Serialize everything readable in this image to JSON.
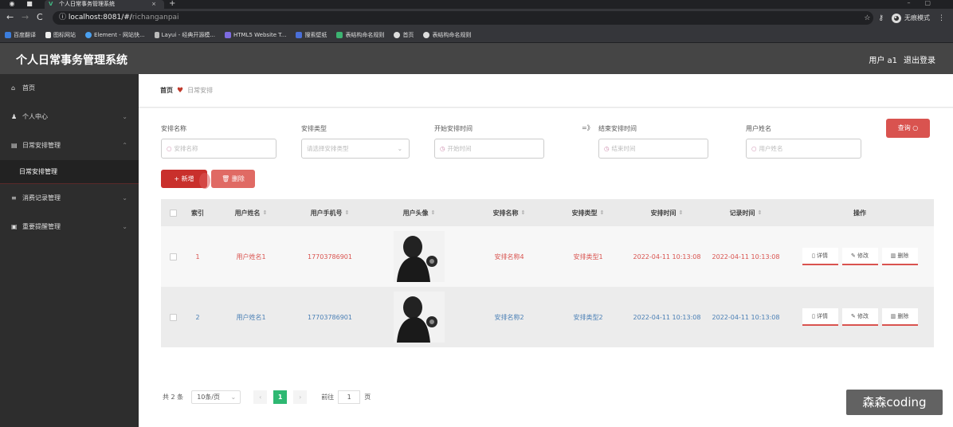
{
  "browser": {
    "tab_title": "个人日常事务管理系统",
    "url_host": "localhost:8081/#/",
    "url_path": "richanganpai",
    "profile_label": "无痕模式",
    "bookmarks": [
      "百度翻译",
      "图标网站",
      "Element - 网站快...",
      "Layui - 经典开源模...",
      "HTML5 Website T...",
      "搜索壁纸",
      "表结构命名规则",
      "首页",
      "表结构命名规则"
    ]
  },
  "header": {
    "title": "个人日常事务管理系统",
    "user": "用户 a1",
    "logout": "退出登录"
  },
  "sidebar": {
    "items": [
      {
        "label": "首页",
        "icon": "home-icon"
      },
      {
        "label": "个人中心",
        "icon": "user-icon"
      },
      {
        "label": "日常安排管理",
        "icon": "calendar-icon"
      },
      {
        "label": "日常安排管理",
        "icon": ""
      },
      {
        "label": "消费记录管理",
        "icon": "list-icon"
      },
      {
        "label": "重要提醒管理",
        "icon": "bell-icon"
      }
    ]
  },
  "breadcrumb": {
    "home": "首页",
    "current": "日常安排"
  },
  "filters": {
    "name_label": "安排名称",
    "name_placeholder": "安排名称",
    "type_label": "安排类型",
    "type_placeholder": "请选择安排类型",
    "start_label": "开始安排时间",
    "start_placeholder": "开始时间",
    "arrow": "=》",
    "end_label": "结束安排时间",
    "end_placeholder": "结束时间",
    "user_label": "用户姓名",
    "user_placeholder": "用户姓名",
    "search_button": "查询"
  },
  "actions": {
    "add": "+ 新增",
    "delete": "删除"
  },
  "table": {
    "headers": [
      "索引",
      "用户姓名",
      "用户手机号",
      "用户头像",
      "安排名称",
      "安排类型",
      "安排时间",
      "记录时间",
      "操作"
    ],
    "rows": [
      {
        "index": "1",
        "name": "用户姓名1",
        "phone": "17703786901",
        "plan_name": "安排名称4",
        "plan_type": "安排类型1",
        "plan_time": "2022-04-11 10:13:08",
        "record_time": "2022-04-11 10:13:08"
      },
      {
        "index": "2",
        "name": "用户姓名1",
        "phone": "17703786901",
        "plan_name": "安排名称2",
        "plan_type": "安排类型2",
        "plan_time": "2022-04-11 10:13:08",
        "record_time": "2022-04-11 10:13:08"
      }
    ],
    "ops": {
      "detail": "详情",
      "edit": "修改",
      "delete": "删除"
    }
  },
  "pagination": {
    "total": "共 2 条",
    "page_size": "10条/页",
    "current_page": "1",
    "goto_label": "前往",
    "goto_value": "1",
    "page_suffix": "页"
  },
  "watermark": "森森coding",
  "colors": {
    "primary": "#d9534f",
    "header": "#454545",
    "sidebar": "#2d2d2d",
    "page_active": "#2eb872"
  }
}
